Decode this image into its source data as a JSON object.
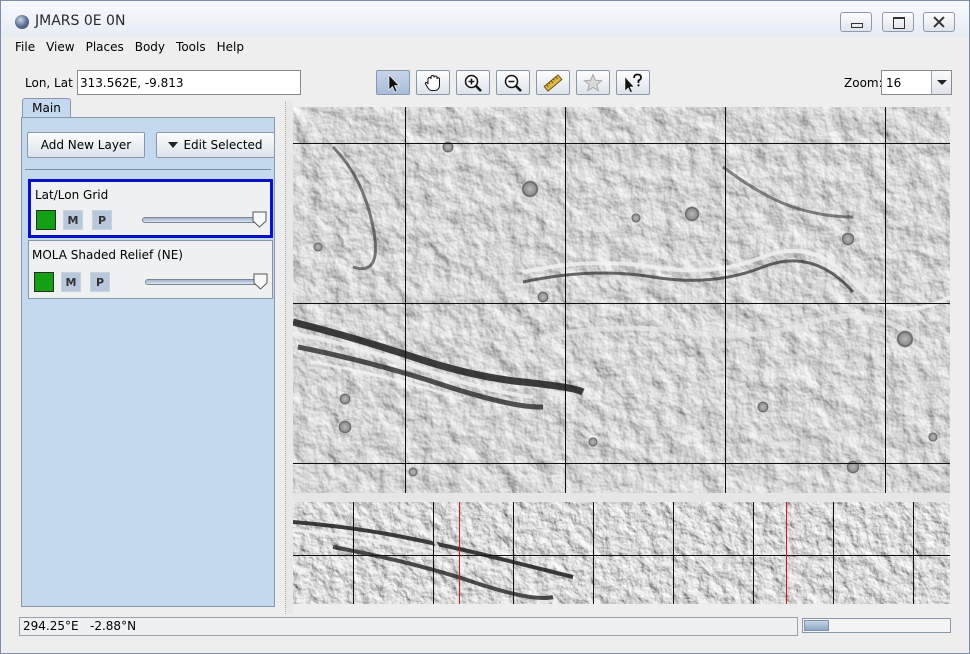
{
  "window": {
    "title": "JMARS 0E 0N"
  },
  "menu": [
    {
      "label": "File"
    },
    {
      "label": "View"
    },
    {
      "label": "Places"
    },
    {
      "label": "Body"
    },
    {
      "label": "Tools"
    },
    {
      "label": "Help"
    }
  ],
  "location": {
    "label": "Lon, Lat",
    "value": "313.562E, -9.813"
  },
  "tools": [
    {
      "icon": "select-arrow-icon",
      "selected": true
    },
    {
      "icon": "pan-hand-icon",
      "selected": false
    },
    {
      "icon": "zoom-in-icon",
      "selected": false
    },
    {
      "icon": "zoom-out-icon",
      "selected": false
    },
    {
      "icon": "measure-ruler-icon",
      "selected": false
    },
    {
      "icon": "star-icon",
      "selected": false
    },
    {
      "icon": "investigate-pointer-icon",
      "selected": false
    }
  ],
  "zoom": {
    "label": "Zoom:",
    "value": "16"
  },
  "panel": {
    "tab_label": "Main",
    "add_layer_label": "Add New Layer",
    "edit_selected_label": "Edit Selected"
  },
  "layers": [
    {
      "name": "Lat/Lon Grid",
      "selected": true,
      "color": "#14a014",
      "m_label": "M",
      "p_label": "P",
      "opacity": 1.0
    },
    {
      "name": "MOLA Shaded Relief (NE)",
      "selected": false,
      "color": "#14a014",
      "m_label": "M",
      "p_label": "P",
      "opacity": 1.0
    }
  ],
  "status": {
    "coords": "294.25°E   -2.88°N",
    "progress": 0.17
  },
  "colors": {
    "panel_bg": "#c5d9ee",
    "selected_border": "#0a10c8",
    "grid_line": "#111111",
    "pan_marker": "#d01818"
  }
}
